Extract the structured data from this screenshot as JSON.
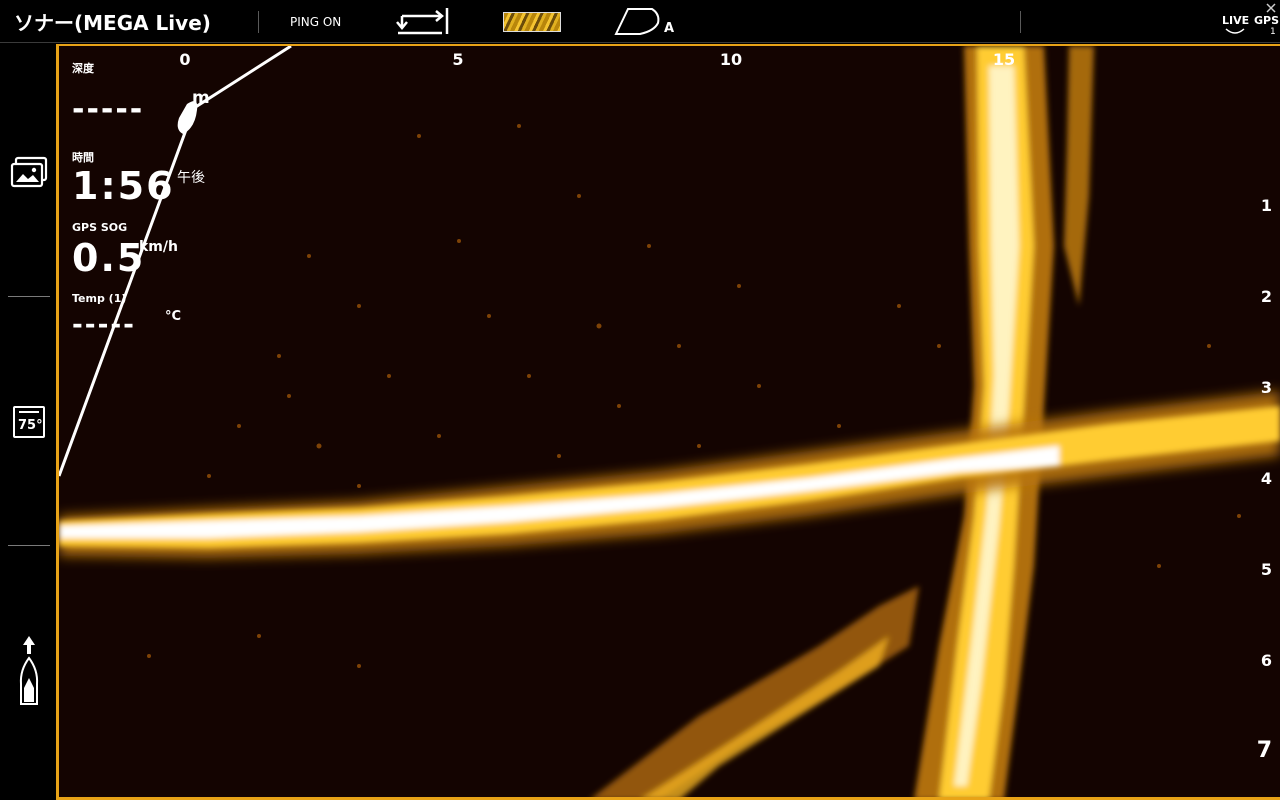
{
  "header": {
    "title": "ソナー(MEGA Live)",
    "ping_label": "PING ON",
    "boat_mode_label": "A",
    "live_label": "LIVE",
    "gps_label": "GPS",
    "gps_count": "1",
    "swap_icon": "swap-direction-icon",
    "palette_icon": "color-palette-icon",
    "boat_mode_icon": "boat-orientation-icon"
  },
  "sidebar": {
    "temp_value": "75°",
    "icons": [
      "gallery-icon",
      "temperature-icon",
      "boat-heading-up-icon"
    ]
  },
  "overlay": {
    "depth_label": "深度",
    "depth_value": "-----",
    "depth_unit": "m",
    "time_label": "時間",
    "time_value": "1:56",
    "time_suffix": "午後",
    "sog_label": "GPS SOG",
    "sog_value": "0.5",
    "sog_unit": "km/h",
    "temp_label": "Temp (1)",
    "temp_value": "-----",
    "temp_unit": "°C"
  },
  "scale": {
    "x_ticks": [
      "0",
      "5",
      "10",
      "15"
    ],
    "y_ticks": [
      "1",
      "2",
      "3",
      "4",
      "5",
      "6",
      "7"
    ]
  },
  "colors": {
    "frame": "#e8a317",
    "background": "#140401",
    "echo": "#ffd24a"
  }
}
